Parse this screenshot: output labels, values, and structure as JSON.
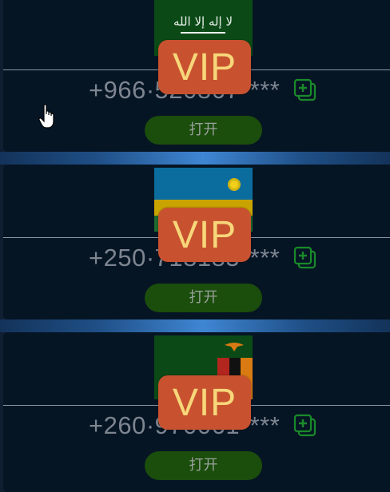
{
  "entries": [
    {
      "country": "Saudi Arabia",
      "flag_icon": "saudi-arabia-flag-icon",
      "flag_text": "لا إله إلا الله",
      "phone": "+966·520867****",
      "vip_label": "VIP",
      "open_label": "打开"
    },
    {
      "country": "Rwanda",
      "flag_icon": "rwanda-flag-icon",
      "phone": "+250·718185****",
      "vip_label": "VIP",
      "open_label": "打开"
    },
    {
      "country": "Zambia",
      "flag_icon": "zambia-flag-icon",
      "phone": "+260·970061****",
      "vip_label": "VIP",
      "open_label": "打开"
    }
  ],
  "colors": {
    "background": "#061524",
    "separator_accent": "#3f86d3",
    "vip_badge": "#c8522f",
    "vip_text": "#f7d77a",
    "open_button": "#1b4d0c",
    "copy_icon": "#1a8a2a"
  },
  "icons": {
    "copy": "copy-plus-icon",
    "cursor": "hand-pointer-icon"
  }
}
